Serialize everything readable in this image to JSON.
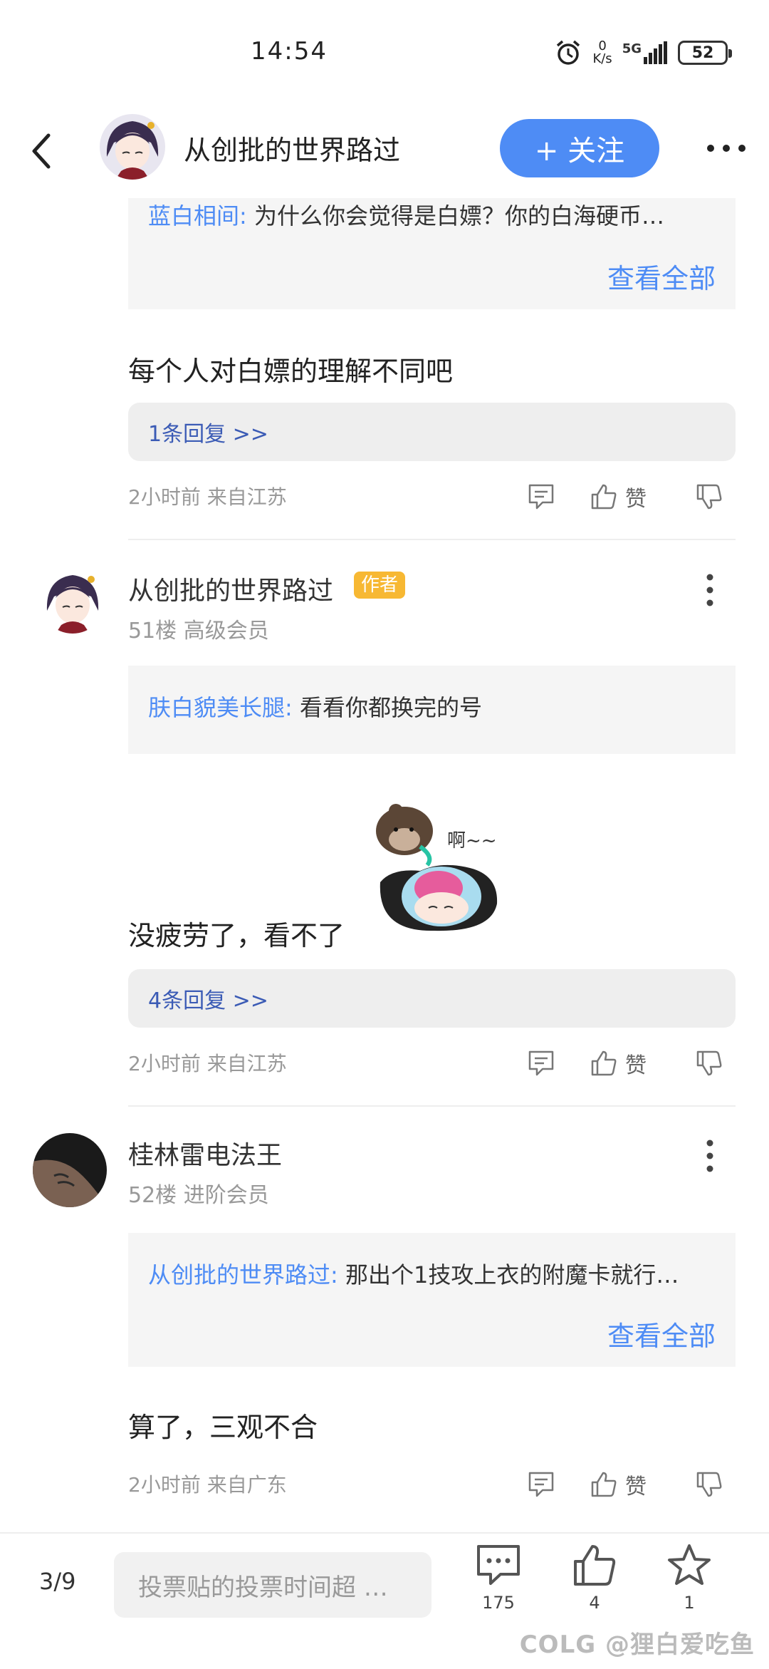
{
  "status_bar": {
    "time": "14:54",
    "net_speed_value": "0",
    "net_speed_unit": "K/s",
    "network": "5G",
    "battery": "52"
  },
  "header": {
    "title": "从创批的世界路过",
    "follow_label": "+ 关注"
  },
  "comments": [
    {
      "quote_author": "蓝白相间:",
      "quote_text": " 为什么你会觉得是白嫖？你的白海硬币…",
      "view_all": "查看全部",
      "text": "每个人对白嫖的理解不同吧",
      "replies": "1条回复 >>",
      "meta": "2小时前 来自江苏",
      "like_label": "赞"
    },
    {
      "user": "从创批的世界路过",
      "badge": "作者",
      "floor": "51楼 高级会员",
      "quote_author": "肤白貌美长腿:",
      "quote_text": " 看看你都换完的号",
      "text": "没疲劳了，看不了",
      "sticker_text": "啊~~",
      "replies": "4条回复 >>",
      "meta": "2小时前 来自江苏",
      "like_label": "赞"
    },
    {
      "user": "桂林雷电法王",
      "floor": "52楼 进阶会员",
      "quote_author": "从创批的世界路过:",
      "quote_text": " 那出个1技攻上衣的附魔卡就行…",
      "view_all": "查看全部",
      "text": "算了，三观不合",
      "meta": "2小时前 来自广东",
      "like_label": "赞"
    }
  ],
  "bottom_bar": {
    "page": "3/9",
    "input_placeholder": "投票贴的投票时间超 …",
    "comment_count": "175",
    "like_count": "4",
    "fav_count": "1"
  },
  "watermark": "COLG @狸白爱吃鱼",
  "colors": {
    "accent": "#4e8cf5",
    "badge": "#f7b833",
    "reply_link": "#3b5bb5"
  }
}
